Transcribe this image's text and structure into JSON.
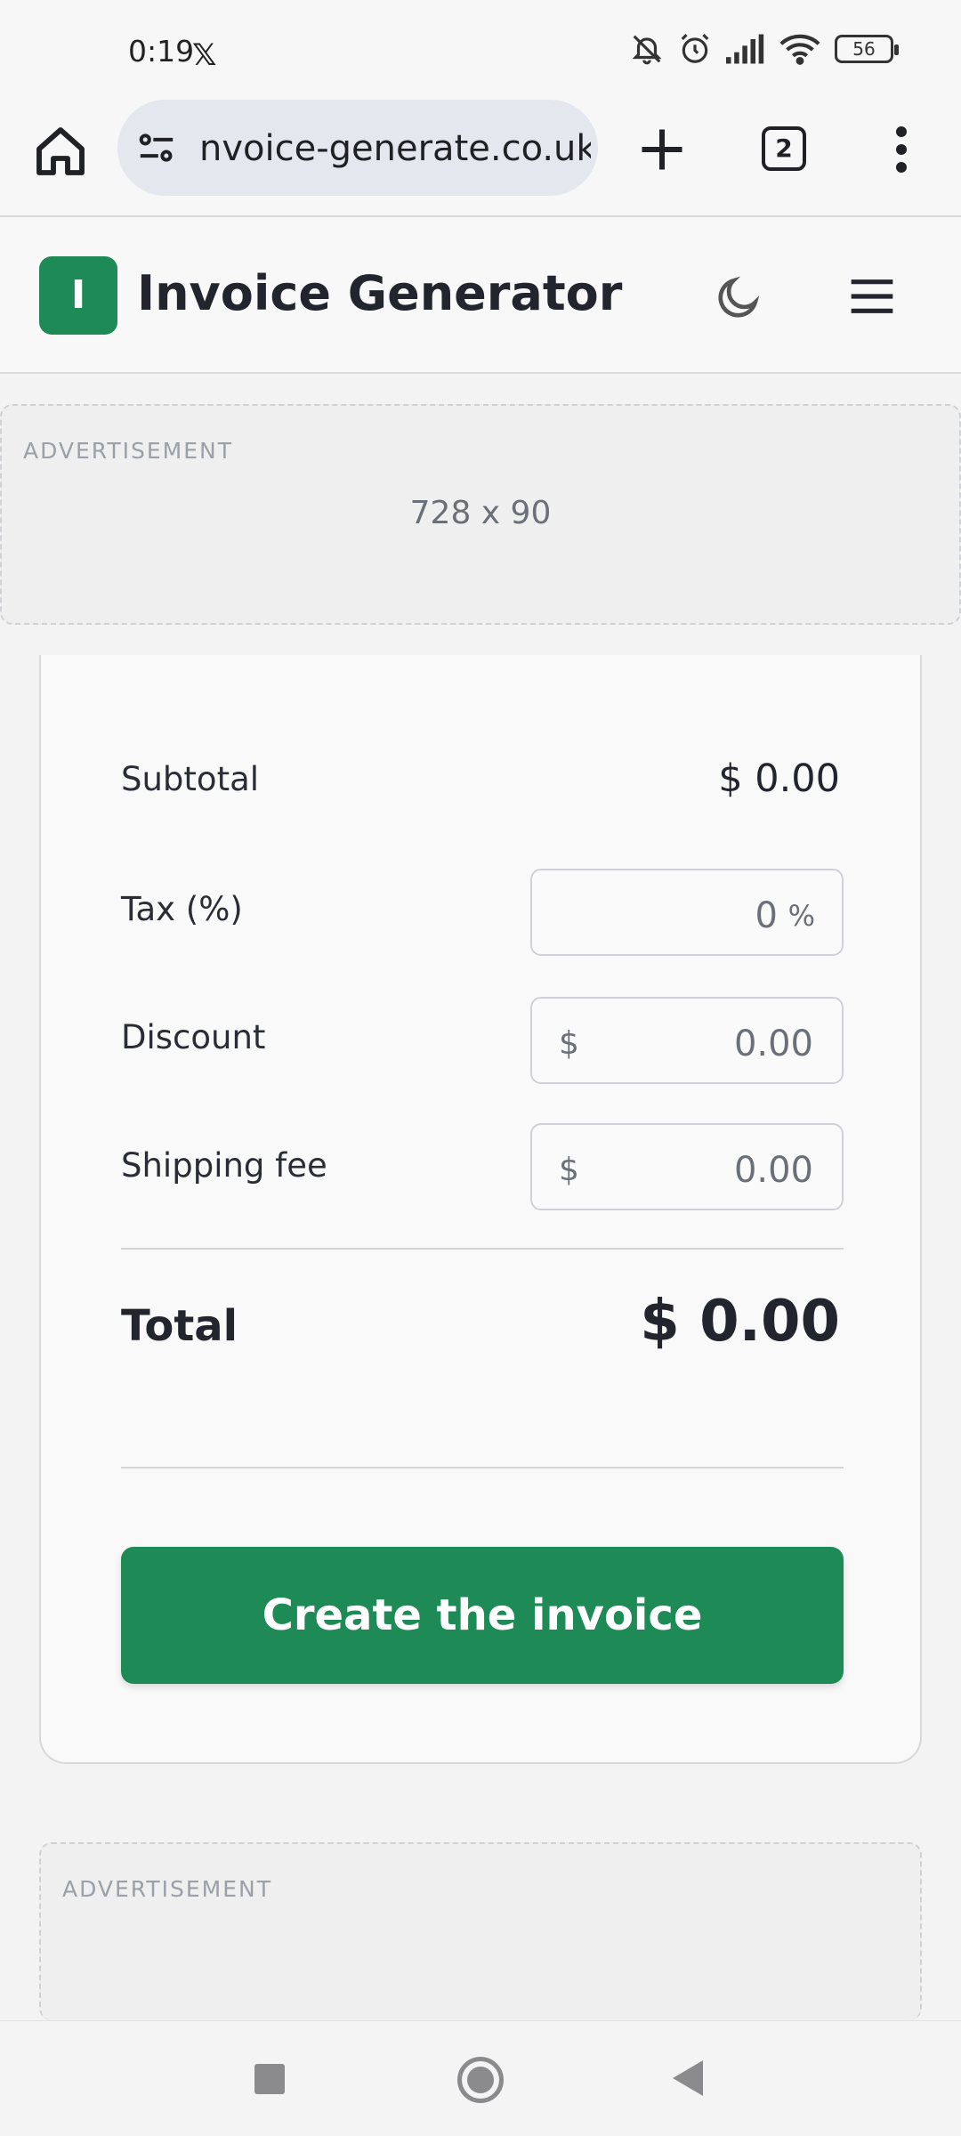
{
  "status_bar": {
    "time": "0:19",
    "battery": "56"
  },
  "browser": {
    "url": "nvoice-generate.co.uk",
    "tab_count": "2"
  },
  "site": {
    "logo_letter": "I",
    "title": "Invoice Generator",
    "brand_color": "#1e8a55"
  },
  "ads": {
    "top_label": "ADVERTISEMENT",
    "top_size": "728 x 90",
    "bottom_label": "ADVERTISEMENT"
  },
  "summary": {
    "subtotal_label": "Subtotal",
    "subtotal_value": "$ 0.00",
    "tax_label": "Tax (%)",
    "tax_value": "0",
    "tax_suffix": "%",
    "discount_label": "Discount",
    "discount_prefix": "$",
    "discount_value": "0.00",
    "shipping_label": "Shipping fee",
    "shipping_prefix": "$",
    "shipping_value": "0.00",
    "total_label": "Total",
    "total_value": "$ 0.00",
    "create_button": "Create the invoice"
  }
}
